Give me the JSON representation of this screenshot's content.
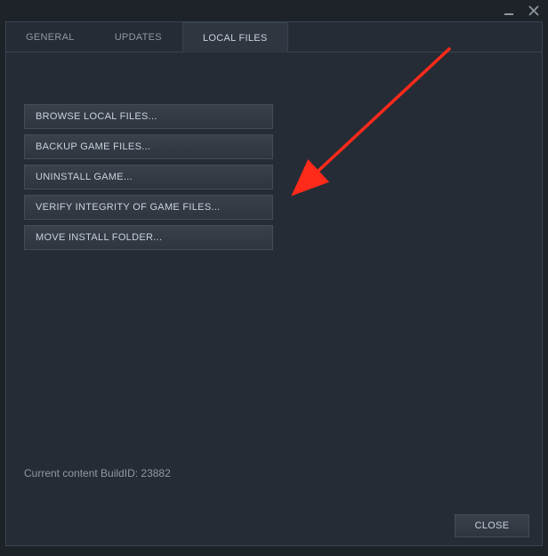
{
  "tabs": {
    "general": "GENERAL",
    "updates": "UPDATES",
    "local_files": "LOCAL FILES"
  },
  "buttons": {
    "browse": "BROWSE LOCAL FILES...",
    "backup": "BACKUP GAME FILES...",
    "uninstall": "UNINSTALL GAME...",
    "verify": "VERIFY INTEGRITY OF GAME FILES...",
    "move": "MOVE INSTALL FOLDER..."
  },
  "build_info": "Current content BuildID: 23882",
  "footer": {
    "close": "CLOSE"
  }
}
